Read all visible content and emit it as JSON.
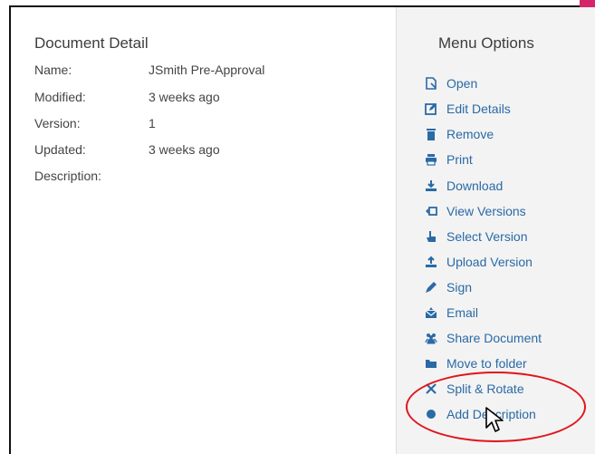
{
  "document_detail": {
    "title": "Document Detail",
    "fields": [
      {
        "label": "Name:",
        "value": "JSmith Pre-Approval"
      },
      {
        "label": "Modified:",
        "value": "3 weeks ago"
      },
      {
        "label": "Version:",
        "value": "1"
      },
      {
        "label": "Updated:",
        "value": "3 weeks ago"
      },
      {
        "label": "Description:",
        "value": ""
      }
    ]
  },
  "menu": {
    "title": "Menu Options",
    "items": [
      {
        "label": "Open",
        "icon": "open-icon"
      },
      {
        "label": "Edit Details",
        "icon": "edit-icon"
      },
      {
        "label": "Remove",
        "icon": "trash-icon"
      },
      {
        "label": "Print",
        "icon": "print-icon"
      },
      {
        "label": "Download",
        "icon": "download-icon"
      },
      {
        "label": "View Versions",
        "icon": "versions-icon"
      },
      {
        "label": "Select Version",
        "icon": "pointer-icon"
      },
      {
        "label": "Upload Version",
        "icon": "upload-icon"
      },
      {
        "label": "Sign",
        "icon": "pen-icon"
      },
      {
        "label": "Email",
        "icon": "email-icon"
      },
      {
        "label": "Share Document",
        "icon": "users-icon"
      },
      {
        "label": "Move to folder",
        "icon": "folder-icon"
      },
      {
        "label": "Split & Rotate",
        "icon": "split-icon"
      },
      {
        "label": "Add Description",
        "icon": "dot-icon"
      }
    ]
  },
  "colors": {
    "link": "#2a6aa6",
    "highlight": "#e1141c",
    "badge": "#d5246a"
  }
}
